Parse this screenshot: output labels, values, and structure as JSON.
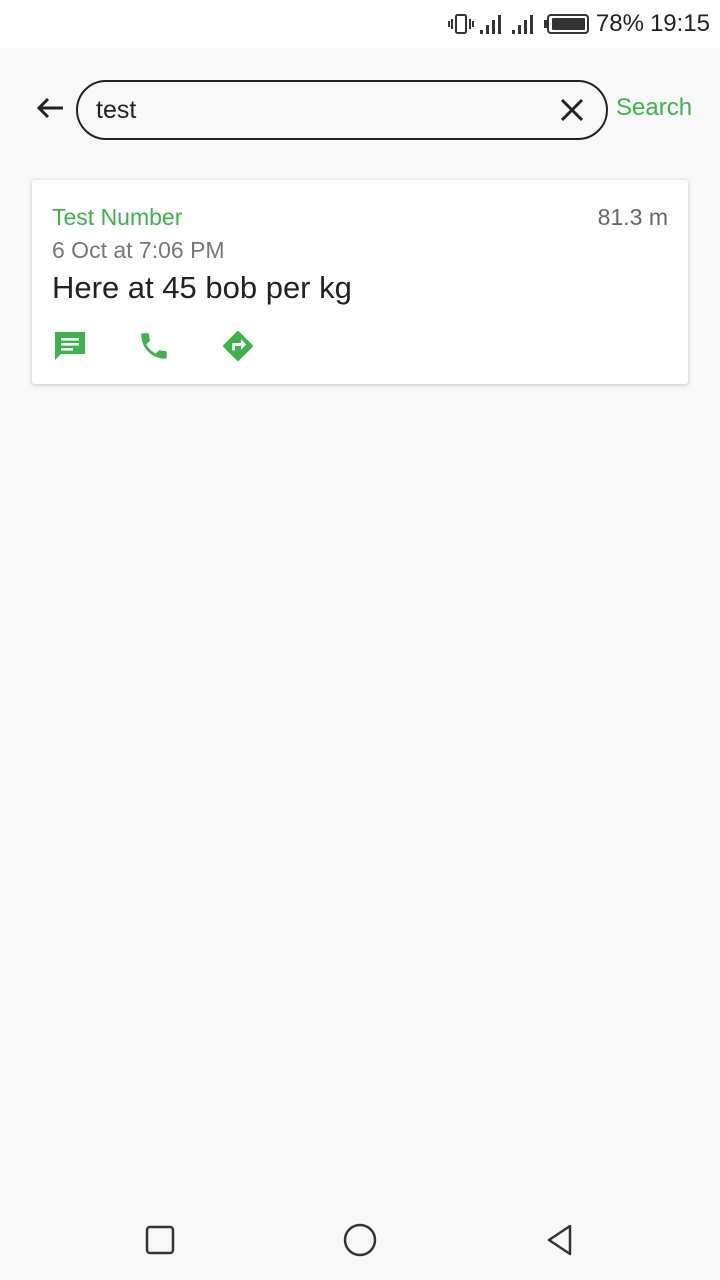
{
  "status_bar": {
    "battery": "78%",
    "time": "19:15",
    "icons": [
      "vibrate-icon",
      "signal-icon",
      "signal-icon",
      "battery-icon"
    ]
  },
  "search": {
    "query": "test",
    "placeholder": "",
    "search_label": "Search",
    "icons": [
      "back-arrow-icon",
      "clear-icon"
    ]
  },
  "results": [
    {
      "name": "Test Number",
      "distance": "81.3 m",
      "date": "6 Oct at 7:06 PM",
      "message": "Here at 45 bob per kg",
      "actions": [
        "message-icon",
        "phone-icon",
        "directions-icon"
      ]
    }
  ],
  "nav_bar": {
    "icons": [
      "recents-square-icon",
      "home-circle-icon",
      "back-triangle-icon"
    ]
  },
  "colors": {
    "accent": "#3bb54a",
    "background": "#f8f8f8",
    "text": "#222222"
  }
}
